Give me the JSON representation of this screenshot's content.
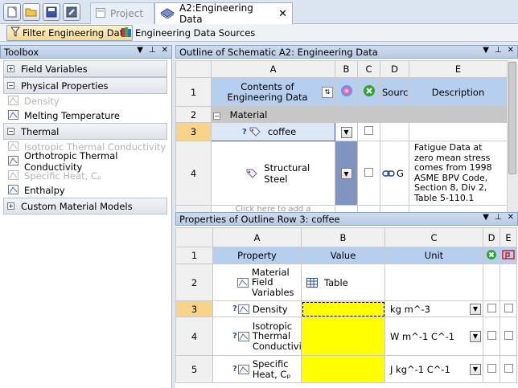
{
  "tabbar": {
    "project_tab": "Project",
    "active_tab": "A2:Engineering Data"
  },
  "toolbar": {
    "filter_label": "Filter Engineering Data",
    "sources_label": "Engineering Data Sources"
  },
  "toolbox": {
    "title": "Toolbox",
    "groups": [
      {
        "label": "Field Variables",
        "expanded": false,
        "items": []
      },
      {
        "label": "Physical Properties",
        "expanded": true,
        "items": [
          {
            "label": "Density",
            "enabled": false
          },
          {
            "label": "Melting Temperature",
            "enabled": true
          }
        ]
      },
      {
        "label": "Thermal",
        "expanded": true,
        "items": [
          {
            "label": "Isotropic Thermal Conductivity",
            "enabled": false
          },
          {
            "label": "Orthotropic Thermal Conductivity",
            "enabled": true
          },
          {
            "label": "Specific Heat, Cₚ",
            "enabled": false
          },
          {
            "label": "Enthalpy",
            "enabled": true
          }
        ]
      },
      {
        "label": "Custom Material Models",
        "expanded": false,
        "items": []
      }
    ]
  },
  "outline": {
    "title": "Outline of Schematic A2: Engineering Data",
    "columns": [
      "A",
      "B",
      "C",
      "D",
      "E"
    ],
    "header": {
      "contents": "Contents of Engineering Data",
      "source": "Source",
      "description": "Description"
    },
    "rows": [
      {
        "num": "2",
        "section": "Material"
      },
      {
        "num": "3",
        "name": "coffee",
        "description": ""
      },
      {
        "num": "4",
        "name": "Structural Steel",
        "source_abbrev": "G",
        "description": "Fatigue Data at zero mean stress comes from 1998 ASME BPV Code, Section 8, Div 2, Table 5-110.1"
      }
    ],
    "add_placeholder": "Click here to add a"
  },
  "props": {
    "title": "Properties of Outline Row 3: coffee",
    "columns": [
      "A",
      "B",
      "C",
      "D",
      "E"
    ],
    "header": {
      "property": "Property",
      "value": "Value",
      "unit": "Unit"
    },
    "rows": [
      {
        "num": "2",
        "property": "Material Field Variables",
        "value": "Table",
        "unit": ""
      },
      {
        "num": "3",
        "property": "Density",
        "value": "",
        "unit": "kg m^-3"
      },
      {
        "num": "4",
        "property": "Isotropic Thermal Conductivity",
        "value": "",
        "unit": "W m^-1 C^-1"
      },
      {
        "num": "5",
        "property": "Specific Heat, Cₚ",
        "value": "",
        "unit": "J kg^-1 C^-1"
      }
    ]
  },
  "colors": {
    "selected_row": "#f8d48b",
    "header_blue": "#b7cfee",
    "missing_value": "#ffff00"
  }
}
